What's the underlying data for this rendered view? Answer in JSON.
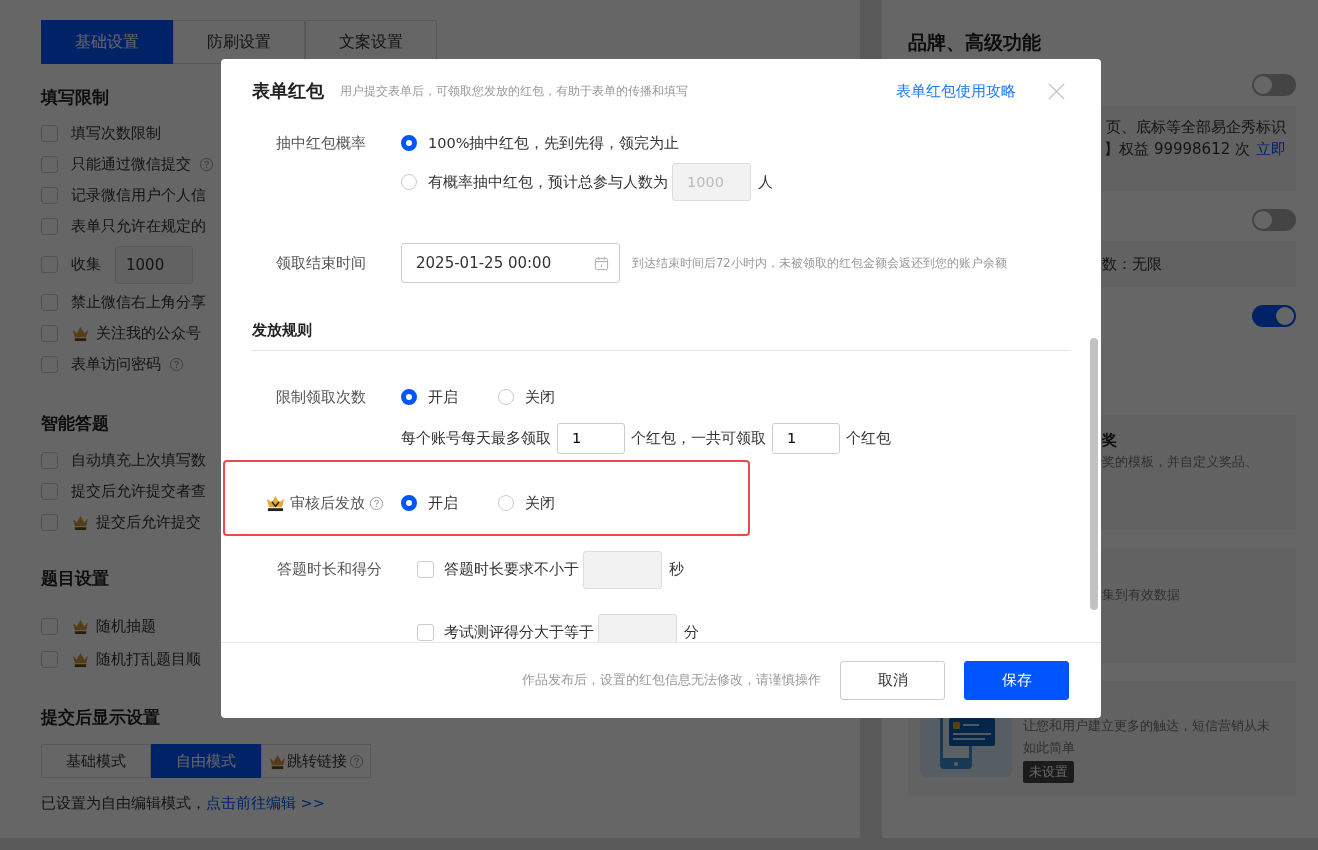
{
  "background": {
    "tabs": [
      {
        "label": "基础设置",
        "selected": true
      },
      {
        "label": "防刷设置",
        "selected": false
      },
      {
        "label": "文案设置",
        "selected": false
      }
    ],
    "sections": [
      {
        "title": "填写限制",
        "items": [
          {
            "kind": "checkbox",
            "label": "填写次数限制",
            "checked": false,
            "premium": false,
            "help": false
          },
          {
            "kind": "checkbox",
            "label": "只能通过微信提交",
            "checked": false,
            "premium": false,
            "help": true
          },
          {
            "kind": "checkbox",
            "label": "记录微信用户个人信",
            "checked": false,
            "premium": false,
            "help": false
          },
          {
            "kind": "checkbox",
            "label": "表单只允许在规定的",
            "checked": false,
            "premium": false,
            "help": false
          },
          {
            "kind": "input",
            "label": "收集",
            "checked": false,
            "premium": false,
            "help": false,
            "value": "1000"
          },
          {
            "kind": "checkbox",
            "label": "禁止微信右上角分享",
            "checked": false,
            "premium": false,
            "help": false
          },
          {
            "kind": "checkbox",
            "label": "关注我的公众号",
            "checked": false,
            "premium": true,
            "help": false
          },
          {
            "kind": "checkbox",
            "label": "表单访问密码",
            "checked": false,
            "premium": false,
            "help": true
          }
        ]
      },
      {
        "title": "智能答题",
        "items": [
          {
            "kind": "checkbox",
            "label": "自动填充上次填写数",
            "checked": false,
            "premium": false,
            "help": false
          },
          {
            "kind": "checkbox",
            "label": "提交后允许提交者查",
            "checked": false,
            "premium": false,
            "help": false
          },
          {
            "kind": "checkbox",
            "label": "提交后允许提交",
            "checked": false,
            "premium": true,
            "help": false
          }
        ]
      },
      {
        "title": "题目设置",
        "items": [
          {
            "kind": "checkbox",
            "label": "随机抽题",
            "checked": false,
            "premium": true,
            "help": false
          },
          {
            "kind": "checkbox",
            "label": "随机打乱题目顺",
            "checked": false,
            "premium": true,
            "help": false
          }
        ]
      }
    ],
    "display": {
      "title": "提交后显示设置",
      "modes": [
        {
          "label": "基础模式",
          "selected": false,
          "premium": false,
          "help": false
        },
        {
          "label": "自由模式",
          "selected": true,
          "premium": false,
          "help": false
        },
        {
          "label": "跳转链接",
          "selected": false,
          "premium": true,
          "help": true
        }
      ],
      "note": "已设置为自由编辑模式，",
      "link": "点击前往编辑 >>"
    },
    "right": {
      "title": "品牌、高级功能",
      "features": [
        {
          "on": false,
          "kind": "wide",
          "lines": [
            {
              "text": "页、底标等全部易企秀标识"
            },
            {
              "text": "】权益 99998612 次",
              "link": "立即"
            }
          ]
        },
        {
          "on": false,
          "kind": "narrow",
          "lines": [
            {
              "text": "数：无限"
            }
          ]
        },
        {
          "on": true
        }
      ],
      "cards": [
        {
          "kind": "text",
          "title": "奖",
          "desc": "奖的模板，并自定义奖品、"
        },
        {
          "kind": "text",
          "desc": "集到有效数据"
        },
        {
          "kind": "illustrated",
          "desc": "让您和用户建立更多的触达，短信营销从未如此简单",
          "badge": "未设置"
        }
      ]
    }
  },
  "modal": {
    "title": "表单红包",
    "subtitle": "用户提交表单后，可领取您发放的红包，有助于表单的传播和填写",
    "link": "表单红包使用攻略",
    "rows": [
      {
        "kind": "radio-list",
        "label": "抽中红包概率",
        "options": [
          {
            "text": "100%抽中红包，先到先得，领完为止",
            "selected": true
          },
          {
            "text": "有概率抽中红包，预计总参与人数为",
            "selected": false,
            "input": "1000",
            "disabled": true,
            "suffix": "人"
          }
        ]
      },
      {
        "kind": "date",
        "label": "领取结束时间",
        "value": "2025-01-25 00:00",
        "hint": "到达结束时间后72小时内，未被领取的红包金额会返还到您的账户余额"
      },
      {
        "kind": "section",
        "label": "发放规则"
      },
      {
        "kind": "radio-inline",
        "label": "限制领取次数",
        "premium": false,
        "help": false,
        "highlighted": false,
        "options": [
          {
            "text": "开启",
            "selected": true
          },
          {
            "text": "关闭",
            "selected": false
          }
        ],
        "sub": [
          {
            "kind": "text",
            "text": "每个账号每天最多领取"
          },
          {
            "kind": "input",
            "value": "1"
          },
          {
            "kind": "text",
            "text": "个红包，一共可领取"
          },
          {
            "kind": "input",
            "value": "1"
          },
          {
            "kind": "text",
            "text": "个红包"
          }
        ]
      },
      {
        "kind": "radio-inline",
        "label": "审核后发放",
        "premium": true,
        "help": true,
        "highlighted": true,
        "options": [
          {
            "text": "开启",
            "selected": true
          },
          {
            "text": "关闭",
            "selected": false
          }
        ]
      },
      {
        "kind": "checks",
        "label": "答题时长和得分",
        "options": [
          {
            "text": "答题时长要求不小于",
            "checked": false,
            "suffix": "秒"
          },
          {
            "text": "考试测评得分大于等于",
            "checked": false,
            "suffix": "分"
          }
        ]
      }
    ],
    "footer": {
      "note": "作品发布后，设置的红包信息无法修改，请谨慎操作",
      "buttons": [
        {
          "label": "取消",
          "kind": "secondary"
        },
        {
          "label": "保存",
          "kind": "primary"
        }
      ]
    }
  }
}
